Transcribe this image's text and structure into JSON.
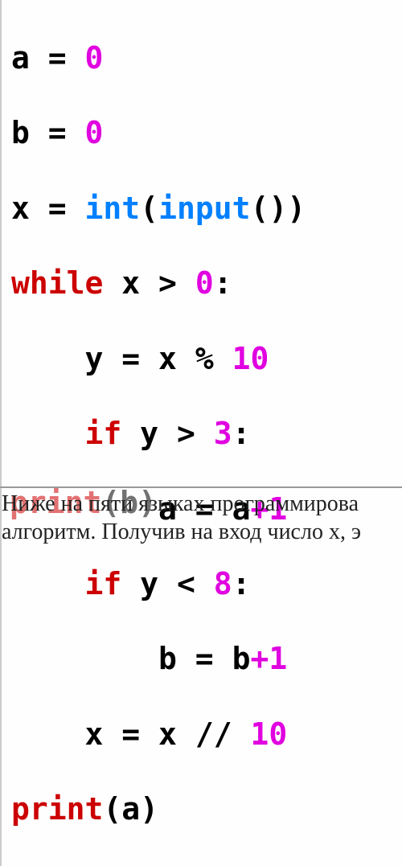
{
  "code": {
    "line1": {
      "a": "a",
      "eq": " = ",
      "zero": "0"
    },
    "line2": {
      "b": "b",
      "eq": " = ",
      "zero": "0"
    },
    "line3": {
      "x": "x",
      "eq": " = ",
      "int": "int",
      "open": "(",
      "input": "input",
      "parens": "())"
    },
    "line4": {
      "while": "while",
      "sp": " ",
      "x": "x",
      "gt": " > ",
      "zero": "0",
      "colon": ":"
    },
    "line5": {
      "indent": "    ",
      "y": "y",
      "eq": " = ",
      "x": "x",
      "mod": " % ",
      "ten": "10"
    },
    "line6": {
      "indent": "    ",
      "if": "if",
      "sp": " ",
      "y": "y",
      "gt": " > ",
      "three": "3",
      "colon": ":"
    },
    "line7": {
      "indent": "        ",
      "a": "a",
      "eq": " = ",
      "a2": "a",
      "plus": "+",
      "one": "1"
    },
    "line8": {
      "indent": "    ",
      "if": "if",
      "sp": " ",
      "y": "y",
      "lt": " < ",
      "eight": "8",
      "colon": ":"
    },
    "line9": {
      "indent": "        ",
      "b": "b",
      "eq": " = ",
      "b2": "b",
      "plus": "+",
      "one": "1"
    },
    "line10": {
      "indent": "    ",
      "x": "x",
      "eq": " = ",
      "x2": "x",
      "div": " // ",
      "ten": "10"
    },
    "line11": {
      "print": "print",
      "open": "(",
      "a": "a",
      "close": ")"
    },
    "line12": {
      "print": "print",
      "open": "(",
      "b": "b",
      "close": ")"
    }
  },
  "caption": {
    "line1": "Ниже на пяти языках программирова",
    "line2": "алгоритм. Получив на вход число x, э"
  }
}
